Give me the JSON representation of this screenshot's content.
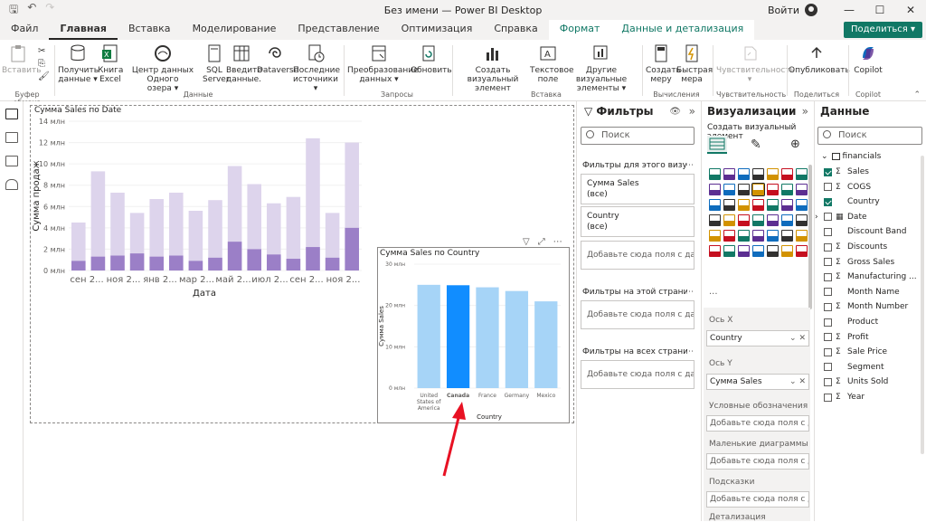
{
  "window": {
    "title": "Без имени — Power BI Desktop",
    "sign_in": "Войти"
  },
  "tabs": [
    "Файл",
    "Главная",
    "Вставка",
    "Моделирование",
    "Представление",
    "Оптимизация",
    "Справка",
    "Формат",
    "Данные и детализация"
  ],
  "share_label": "Поделиться",
  "ribbon": {
    "buttons": [
      {
        "label": "Вставить",
        "sub": ""
      },
      {
        "label": "Получить",
        "sub": "данные"
      },
      {
        "label": "Книга",
        "sub": "Excel"
      },
      {
        "label": "Центр данных Одного",
        "sub": "озера"
      },
      {
        "label": "SQL",
        "sub": "Server"
      },
      {
        "label": "Введите",
        "sub": "данные."
      },
      {
        "label": "Dataverse",
        "sub": ""
      },
      {
        "label": "Последние",
        "sub": "источники"
      },
      {
        "label": "Преобразование",
        "sub": "данных"
      },
      {
        "label": "Обновить",
        "sub": ""
      },
      {
        "label": "Создать визуальный",
        "sub": "элемент"
      },
      {
        "label": "Текстовое",
        "sub": "поле"
      },
      {
        "label": "Другие визуальные",
        "sub": "элементы"
      },
      {
        "label": "Создать",
        "sub": "меру"
      },
      {
        "label": "Быстрая",
        "sub": "мера"
      },
      {
        "label": "Чувствительность",
        "sub": ""
      },
      {
        "label": "Опубликовать",
        "sub": ""
      },
      {
        "label": "Copilot",
        "sub": ""
      }
    ],
    "groups": [
      "Буфер обмена",
      "Данные",
      "Запросы",
      "Вставка",
      "Вычисления",
      "Чувствительность",
      "Поделиться",
      "Copilot"
    ]
  },
  "chart1": {
    "title": "Сумма Sales по Date",
    "chart_data": {
      "type": "bar",
      "stacked": true,
      "xlabel": "Дата",
      "ylabel": "Сумма продаж",
      "ylim": [
        0,
        14
      ],
      "yticks": [
        "0 млн",
        "2 млн",
        "4 млн",
        "6 млн",
        "8 млн",
        "10 млн",
        "12 млн",
        "14 млн"
      ],
      "xticks": [
        "сен 2...",
        "ноя 2...",
        "янв 2...",
        "мар 2...",
        "май 2...",
        "июл 2...",
        "сен 2...",
        "ноя 2..."
      ],
      "series": [
        {
          "name": "base",
          "color": "#9b7fc7",
          "values": [
            0.9,
            1.3,
            1.4,
            1.6,
            1.3,
            1.4,
            0.9,
            1.2,
            2.7,
            2.0,
            1.5,
            1.1,
            2.2,
            1.2,
            4.0
          ]
        },
        {
          "name": "top",
          "color": "#ddd4ec",
          "values": [
            4.5,
            9.3,
            7.3,
            5.4,
            6.7,
            7.3,
            5.6,
            6.6,
            9.8,
            8.1,
            6.3,
            6.9,
            12.4,
            5.4,
            12.0
          ]
        }
      ]
    }
  },
  "chart2": {
    "title": "Сумма Sales по Country",
    "chart_data": {
      "type": "bar",
      "xlabel": "Country",
      "ylabel": "Сумма Sales",
      "ylim": [
        0,
        30
      ],
      "yticks": [
        "0 млн",
        "10 млн",
        "20 млн",
        "30 млн"
      ],
      "categories": [
        "United States of America",
        "Canada",
        "France",
        "Germany",
        "Mexico"
      ],
      "values": [
        25.0,
        24.9,
        24.4,
        23.5,
        21.0
      ],
      "highlight": "Canada",
      "colors": {
        "normal": "#a6d4f7",
        "highlight": "#118dff"
      }
    }
  },
  "filters": {
    "title": "Фильтры",
    "search": "Поиск",
    "visual_section": "Фильтры для этого визуальн...",
    "cards": [
      {
        "name": "Сумма Sales",
        "value": "(все)"
      },
      {
        "name": "Country",
        "value": "(все)"
      }
    ],
    "add_here": "Добавьте сюда поля с дан...",
    "page_section": "Фильтры на этой странице",
    "all_section": "Фильтры на всех страницах"
  },
  "viz": {
    "title": "Визуализации",
    "build": "Создать визуальный элемент",
    "x_axis_label": "Ось X",
    "x_axis_value": "Country",
    "y_axis_label": "Ось Y",
    "y_axis_value": "Сумма Sales",
    "legend_label": "Условные обозначения",
    "small_label": "Маленькие диаграммы",
    "tooltips_label": "Подсказки",
    "drill_label": "Детализация",
    "add_here": "Добавьте сюда поля с дан..."
  },
  "data_pane": {
    "title": "Данные",
    "search": "Поиск",
    "table": "financials",
    "fields": [
      {
        "name": "Sales",
        "sigma": true,
        "checked": true
      },
      {
        "name": "COGS",
        "sigma": true,
        "checked": false
      },
      {
        "name": "Country",
        "sigma": false,
        "checked": true
      },
      {
        "name": "Date",
        "sigma": false,
        "checked": false
      },
      {
        "name": "Discount Band",
        "sigma": false,
        "checked": false
      },
      {
        "name": "Discounts",
        "sigma": true,
        "checked": false
      },
      {
        "name": "Gross Sales",
        "sigma": true,
        "checked": false
      },
      {
        "name": "Manufacturing ...",
        "sigma": true,
        "checked": false
      },
      {
        "name": "Month Name",
        "sigma": false,
        "checked": false
      },
      {
        "name": "Month Number",
        "sigma": true,
        "checked": false
      },
      {
        "name": "Product",
        "sigma": false,
        "checked": false
      },
      {
        "name": "Profit",
        "sigma": true,
        "checked": false
      },
      {
        "name": "Sale Price",
        "sigma": true,
        "checked": false
      },
      {
        "name": "Segment",
        "sigma": false,
        "checked": false
      },
      {
        "name": "Units Sold",
        "sigma": true,
        "checked": false
      },
      {
        "name": "Year",
        "sigma": true,
        "checked": false
      }
    ]
  }
}
